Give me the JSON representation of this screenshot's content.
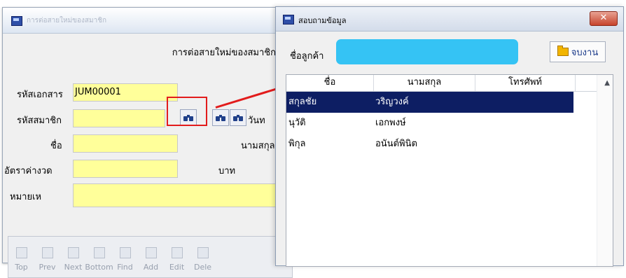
{
  "back_window": {
    "title": "การต่อสายใหม่ของสมาชิก",
    "heading": "การต่อสายใหม่ของสมาชิก",
    "fields": {
      "doc_id_label": "รหัสเอกสาร",
      "doc_id_value": "JUM00001",
      "member_id_label": "รหัสสมาชิก",
      "first_name_label": "ชื่อ",
      "last_name_label": "นามสกุล",
      "install_rate_label": "อัตราค่างวด",
      "baht_label": "บาท",
      "note_label": "หมายเห",
      "date_label": "วันท"
    },
    "nav_buttons": [
      "Top",
      "Prev",
      "Next",
      "Bottom",
      "Find",
      "Add",
      "Edit",
      "Dele"
    ]
  },
  "front_window": {
    "title": "สอบถามข้อมูล",
    "close_label": "✕",
    "customer_label": "ชื่อลูกค้า",
    "search": {
      "value": "",
      "placeholder": ""
    },
    "close_job_label": "จบงาน",
    "columns": [
      "ชื่อ",
      "นามสกุล",
      "โทรศัพท์"
    ],
    "rows": [
      {
        "first": "สกุลชัย",
        "last": "วริญวงค์",
        "phone": ""
      },
      {
        "first": "นุวัติ",
        "last": "เอกพงษ์",
        "phone": ""
      },
      {
        "first": "พิกุล",
        "last": "อนันต์พินิต",
        "phone": ""
      }
    ],
    "selected_row": 0
  },
  "colors": {
    "field_bg": "#ffff9a",
    "search_bg": "#35c3f4",
    "selected_row_bg": "#0d1e63",
    "highlight_red": "#e21c1c"
  },
  "icons": [
    "window-icon",
    "binoculars-icon",
    "folder-icon",
    "close-icon",
    "scroll-up-icon"
  ]
}
